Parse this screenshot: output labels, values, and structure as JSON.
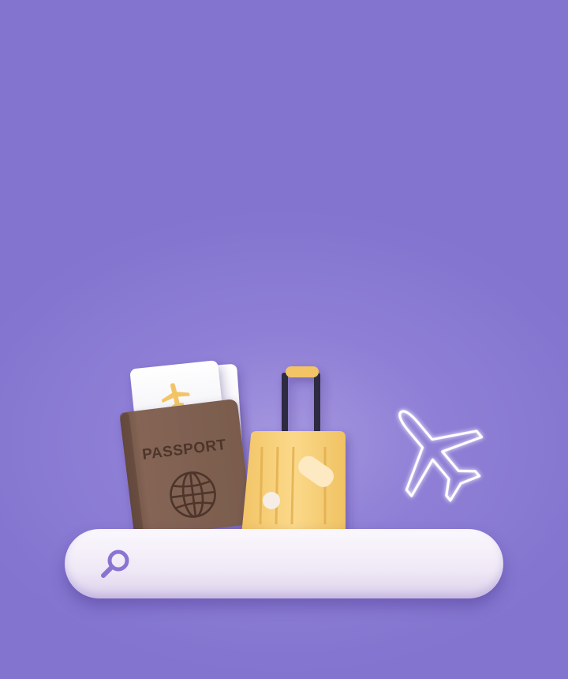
{
  "passport": {
    "label": "PASSPORT"
  },
  "search": {
    "value": "",
    "placeholder": ""
  },
  "icons": {
    "search": "search-icon",
    "globe": "globe-icon",
    "ticket_plane": "airplane-icon",
    "neon_plane": "airplane-icon"
  },
  "colors": {
    "background": "#8274cf",
    "passport": "#7a5d4e",
    "suitcase": "#f6cf7a",
    "ticket": "#f3f1f5",
    "search_bar": "#f6f1fa",
    "search_icon": "#8a74d2"
  }
}
